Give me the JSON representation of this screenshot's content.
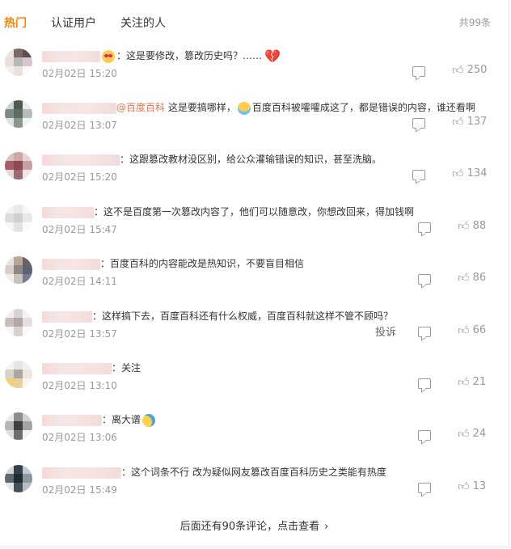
{
  "tabs": [
    {
      "label": "热门",
      "active": true
    },
    {
      "label": "认证用户",
      "active": false
    },
    {
      "label": "关注的人",
      "active": false
    }
  ],
  "total": "共99条",
  "comments": [
    {
      "text": "：这是要修改，篡改历史吗？……",
      "time": "02月02日 15:20",
      "likes": "250",
      "emoji": "love",
      "heart": true,
      "colors": [
        "#f0e0e0",
        "#7a6a6a",
        "#5a4f4f",
        "#e9dede",
        "#b8b8b8",
        "#d6c8c8",
        "#f3ecec",
        "#e7e1e1",
        "#fafafa"
      ]
    },
    {
      "pre": "",
      "mention": "@百度百科",
      "text": " 这是要搞哪样，",
      "text2": "百度百科被嚯嚯成这了，都是错误的内容，谁还看啊",
      "time": "02月02日 13:07",
      "likes": "137",
      "emoji": "cry",
      "colors": [
        "#cfd3cf",
        "#4c5a52",
        "#e8ecea",
        "#7e8a84",
        "#5f6b65",
        "#b6bdb9",
        "#dde1df",
        "#8b9690",
        "#f1f3f2"
      ]
    },
    {
      "text": "：这跟篡改教材没区别，给公众灌输错误的知识，甚至洗脑。",
      "time": "02月02日 15:20",
      "likes": "134",
      "colors": [
        "#d8c4c4",
        "#cfa7a7",
        "#e6d3d3",
        "#a85c66",
        "#8a4b55",
        "#c2a0a4",
        "#e8d8d8",
        "#9c6a72",
        "#f0e4e4"
      ]
    },
    {
      "text": "：这不是百度第一次篡改内容了，他们可以随意改，你想改回来，得加钱啊",
      "time": "02月02日 15:47",
      "likes": "88",
      "colors": [
        "#f2f2f2",
        "#eaeaea",
        "#f6f6f6",
        "#dddddd",
        "#cfcfcf",
        "#e9e9e9",
        "#f5f5f5",
        "#e2e2e2",
        "#fafafa"
      ]
    },
    {
      "text": "：百度百科的内容能改是热知识，不要盲目相信",
      "time": "02月02日 14:11",
      "likes": "86",
      "colors": [
        "#e9e3dc",
        "#b7a79a",
        "#6d6260",
        "#d8cfc8",
        "#8e8686",
        "#5e6073",
        "#f1ede9",
        "#c9c1bb",
        "#7a7890"
      ]
    },
    {
      "text": "：这样搞下去，百度百科还有什么权威，百度百科就这样不管不顾吗？",
      "time": "02月02日 13:57",
      "likes": "66",
      "report": "投诉",
      "colors": [
        "#f2eeee",
        "#d9d2d2",
        "#f6f2f2",
        "#c7bdbd",
        "#b2a6a6",
        "#e6dfdf",
        "#f7f4f4",
        "#d8cfcf",
        "#fbfafa"
      ]
    },
    {
      "text": "：关注",
      "time": "02月02日 13:10",
      "likes": "21",
      "colors": [
        "#f4f4f4",
        "#e6e6e6",
        "#f0f0f0",
        "#d9d4c8",
        "#a9a79e",
        "#ece8de",
        "#f1d27a",
        "#e8d29a",
        "#f6f6f6"
      ]
    },
    {
      "text": "：离大谱",
      "time": "02月02日 13:06",
      "likes": "24",
      "emoji": "laugh",
      "colors": [
        "#e9e9e9",
        "#8c8c8c",
        "#d0d0d0",
        "#b5b5b5",
        "#3f3f3f",
        "#a3a3a3",
        "#dedede",
        "#6e6e6e",
        "#f2f2f2"
      ]
    },
    {
      "text": "：这个词条不行 改为疑似网友篡改百度百科历史之类能有热度",
      "time": "02月02日 15:49",
      "likes": "13",
      "colors": [
        "#d3d7da",
        "#34404a",
        "#c2c9cf",
        "#5c6770",
        "#222a31",
        "#8d979f",
        "#e2e6e9",
        "#454f58",
        "#b7bec4"
      ]
    }
  ],
  "more": "后面还有90条评论，点击查看"
}
